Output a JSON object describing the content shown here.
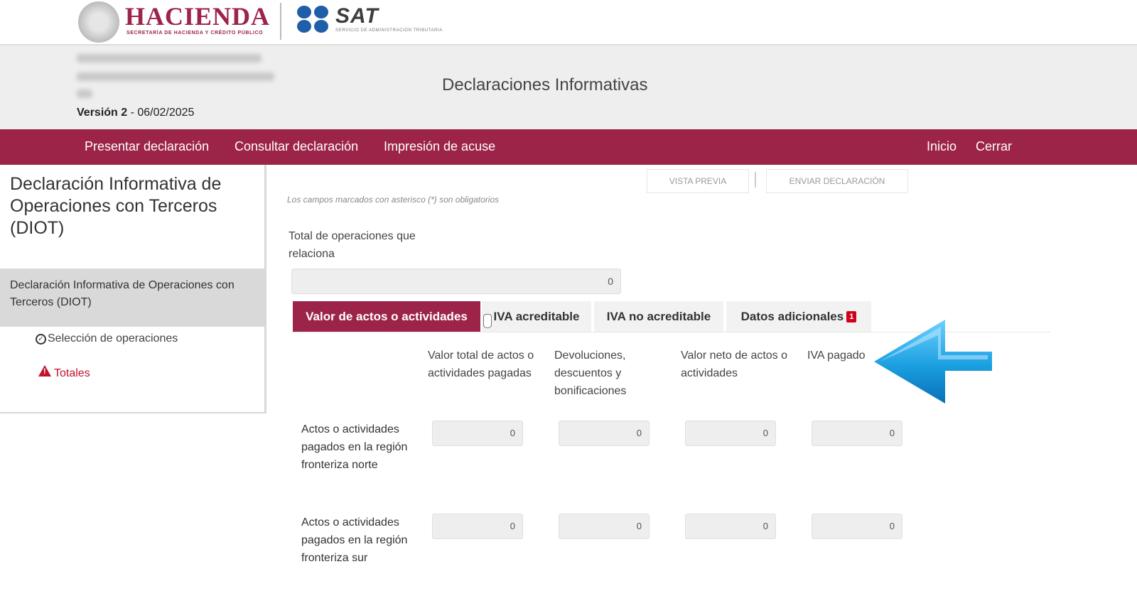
{
  "header": {
    "hacienda_brand": "HACIENDA",
    "hacienda_sub": "SECRETARÍA DE HACIENDA Y CRÉDITO PÚBLICO",
    "sat_brand": "SAT",
    "sat_sub": "SERVICIO DE ADMINISTRACIÓN TRIBUTARIA",
    "version_label": "Versión 2",
    "version_date": " - 06/02/2025",
    "page_title": "Declaraciones Informativas"
  },
  "nav": {
    "presentar": "Presentar declaración",
    "consultar": "Consultar declaración",
    "impresion": "Impresión de acuse",
    "inicio": "Inicio",
    "cerrar": "Cerrar"
  },
  "sidebar": {
    "title": "Declaración Informativa de Operaciones con Terceros (DIOT)",
    "active_item": "Declaración Informativa de Operaciones con Terceros (DIOT)",
    "seleccion": "Selección de operaciones",
    "totales": "Totales"
  },
  "main": {
    "vista_previa": "VISTA PREVIA",
    "enviar": "ENVIAR DECLARACIÓN",
    "note": "Los campos marcados con asterisco (*) son obligatorios",
    "total_label": "Total de operaciones que relaciona",
    "total_value": "0",
    "tabs": [
      {
        "label": "Valor de actos o actividades"
      },
      {
        "label": "IVA acreditable"
      },
      {
        "label": "IVA no acreditable"
      },
      {
        "label": "Datos adicionales",
        "badge": "1"
      }
    ],
    "columns": [
      "Valor total de actos o actividades pagadas",
      "Devoluciones, descuentos y bonificaciones",
      "Valor neto de actos o actividades",
      "IVA pagado"
    ],
    "rows": [
      {
        "label": "Actos o actividades pagados en la región fronteriza norte",
        "values": [
          "0",
          "0",
          "0",
          "0"
        ]
      },
      {
        "label": "Actos o actividades pagados en la región fronteriza sur",
        "values": [
          "0",
          "0",
          "0",
          "0"
        ]
      }
    ]
  },
  "colors": {
    "brand": "#9d2449",
    "sat_blue": "#1f5ea8",
    "arrow": "#1a9fe0",
    "badge": "#d0021b"
  }
}
